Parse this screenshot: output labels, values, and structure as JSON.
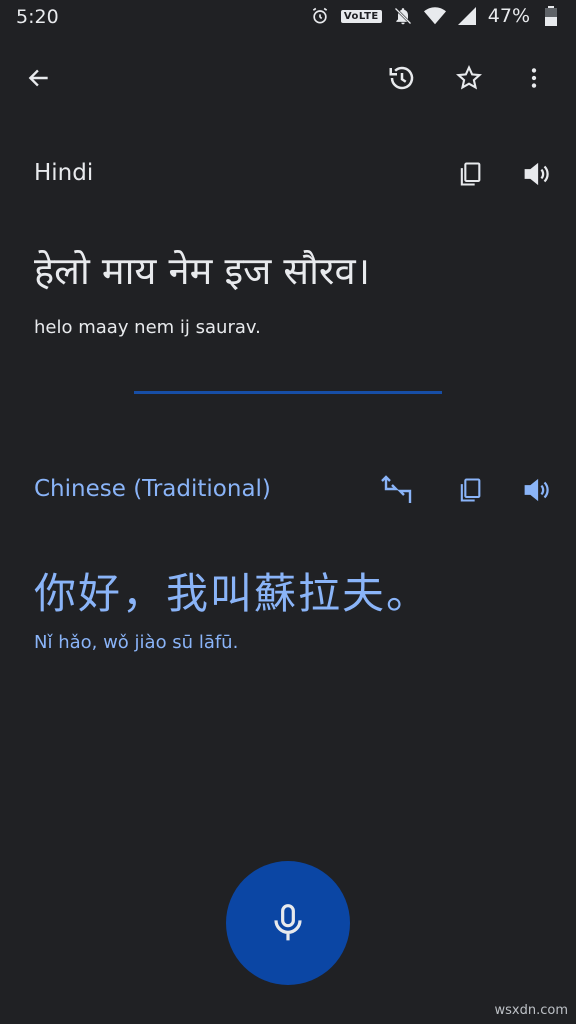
{
  "status_bar": {
    "time": "5:20",
    "volte": "VoLTE",
    "battery": "47%"
  },
  "toolbar": {
    "icons": [
      "back-arrow-icon",
      "history-icon",
      "star-icon",
      "more-vert-icon"
    ]
  },
  "source": {
    "language": "Hindi",
    "text": "हेलो माय नेम इज सौरव।",
    "transliteration": "helo maay nem ij saurav."
  },
  "target": {
    "language": "Chinese (Traditional)",
    "text": "你好，我叫蘇拉夫。",
    "transliteration": "Nǐ hǎo, wǒ jiào sū lāfū."
  },
  "colors": {
    "background": "#202124",
    "text": "#e8eaed",
    "accent": "#8ab4f8",
    "mic": "#0b46a4"
  },
  "watermark": "wsxdn.com"
}
